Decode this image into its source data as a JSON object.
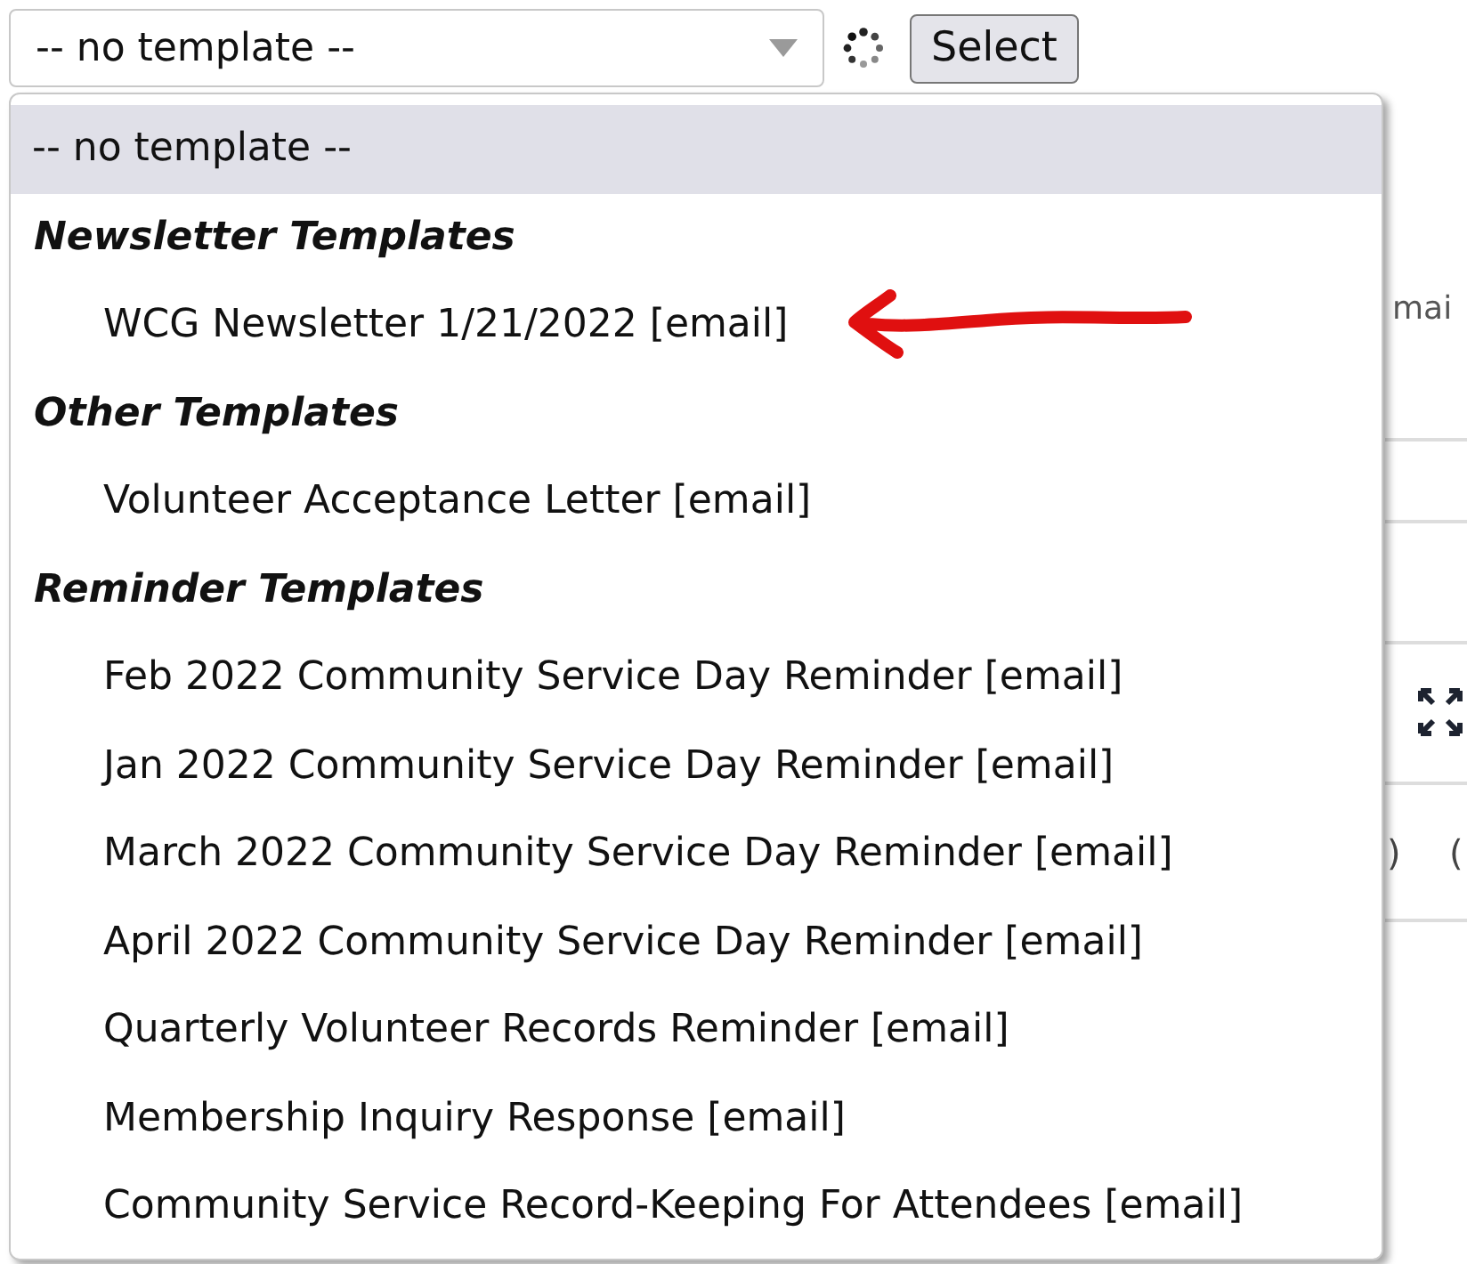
{
  "template_select": {
    "value": "-- no template --"
  },
  "select_button": {
    "label": "Select"
  },
  "dropdown": {
    "options": [
      {
        "kind": "option",
        "label": "-- no template --",
        "selected": true
      },
      {
        "kind": "group",
        "label": "Newsletter Templates",
        "items": [
          {
            "label": "WCG Newsletter 1/21/2022 [email]",
            "selected": false
          }
        ]
      },
      {
        "kind": "group",
        "label": "Other Templates",
        "items": [
          {
            "label": "Volunteer Acceptance Letter [email]",
            "selected": false
          }
        ]
      },
      {
        "kind": "group",
        "label": "Reminder Templates",
        "items": [
          {
            "label": "Feb 2022 Community Service Day Reminder [email]",
            "selected": false
          },
          {
            "label": "Jan 2022 Community Service Day Reminder [email]",
            "selected": false
          },
          {
            "label": "March 2022 Community Service Day Reminder [email]",
            "selected": false
          },
          {
            "label": "April 2022 Community Service Day Reminder [email]",
            "selected": false
          },
          {
            "label": "Quarterly Volunteer Records Reminder [email]",
            "selected": false
          },
          {
            "label": "Membership Inquiry Response [email]",
            "selected": false
          },
          {
            "label": "Community Service Record-Keeping For Attendees [email]",
            "selected": false
          }
        ]
      }
    ]
  },
  "background": {
    "label_fragment": "mai",
    "paren_left": ")",
    "paren_right": "("
  }
}
